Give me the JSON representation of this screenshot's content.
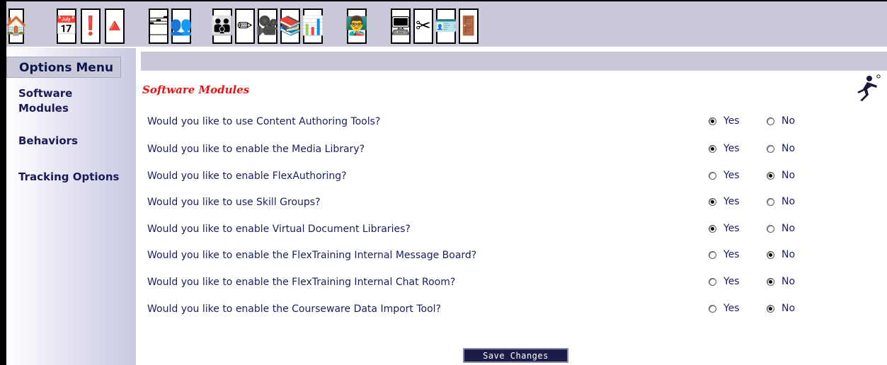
{
  "toolbar": {
    "buttons": [
      {
        "name": "home-icon",
        "glyph": "🏠"
      },
      {
        "name": "calendar-icon",
        "glyph": "📅"
      },
      {
        "name": "alert-icon",
        "glyph": "❗"
      },
      {
        "name": "pyramid-icon",
        "glyph": "🔺"
      },
      {
        "name": "org-chart-icon",
        "glyph": "🗂"
      },
      {
        "name": "users-icon",
        "glyph": "👥"
      },
      {
        "name": "group-icon",
        "glyph": "👪"
      },
      {
        "name": "edit-icon",
        "glyph": "✏"
      },
      {
        "name": "projector-icon",
        "glyph": "🎥"
      },
      {
        "name": "library-icon",
        "glyph": "📚"
      },
      {
        "name": "chart-icon",
        "glyph": "📊"
      },
      {
        "name": "presenter-icon",
        "glyph": "👨‍🏫"
      },
      {
        "name": "computer-icon",
        "glyph": "🖥"
      },
      {
        "name": "tools-icon",
        "glyph": "✂"
      },
      {
        "name": "profile-icon",
        "glyph": "🪪"
      },
      {
        "name": "exit-icon",
        "glyph": "🚪"
      }
    ]
  },
  "sidebar": {
    "title": "Options Menu",
    "items": [
      {
        "label": "Software Modules"
      },
      {
        "label": "Behaviors"
      },
      {
        "label": "Tracking Options"
      }
    ]
  },
  "main": {
    "section_title": "Software Modules",
    "yes_label": "Yes",
    "no_label": "No",
    "questions": [
      {
        "text": "Would you like to use Content Authoring Tools?",
        "selected": "Yes"
      },
      {
        "text": "Would you like to enable the Media Library?",
        "selected": "Yes"
      },
      {
        "text": "Would you like to enable FlexAuthoring?",
        "selected": "No"
      },
      {
        "text": "Would you like to use Skill Groups?",
        "selected": "Yes"
      },
      {
        "text": "Would you like to enable Virtual Document Libraries?",
        "selected": "Yes"
      },
      {
        "text": "Would you like to enable the FlexTraining Internal Message Board?",
        "selected": "No"
      },
      {
        "text": "Would you like to enable the FlexTraining Internal Chat Room?",
        "selected": "No"
      },
      {
        "text": "Would you like to enable the Courseware Data Import Tool?",
        "selected": "No"
      }
    ],
    "save_label": "Save Changes"
  },
  "colors": {
    "frame": "#c9c9d9",
    "title_red": "#ee1111",
    "text_navy": "#1a1f5c",
    "button_navy": "#1c1c48"
  }
}
